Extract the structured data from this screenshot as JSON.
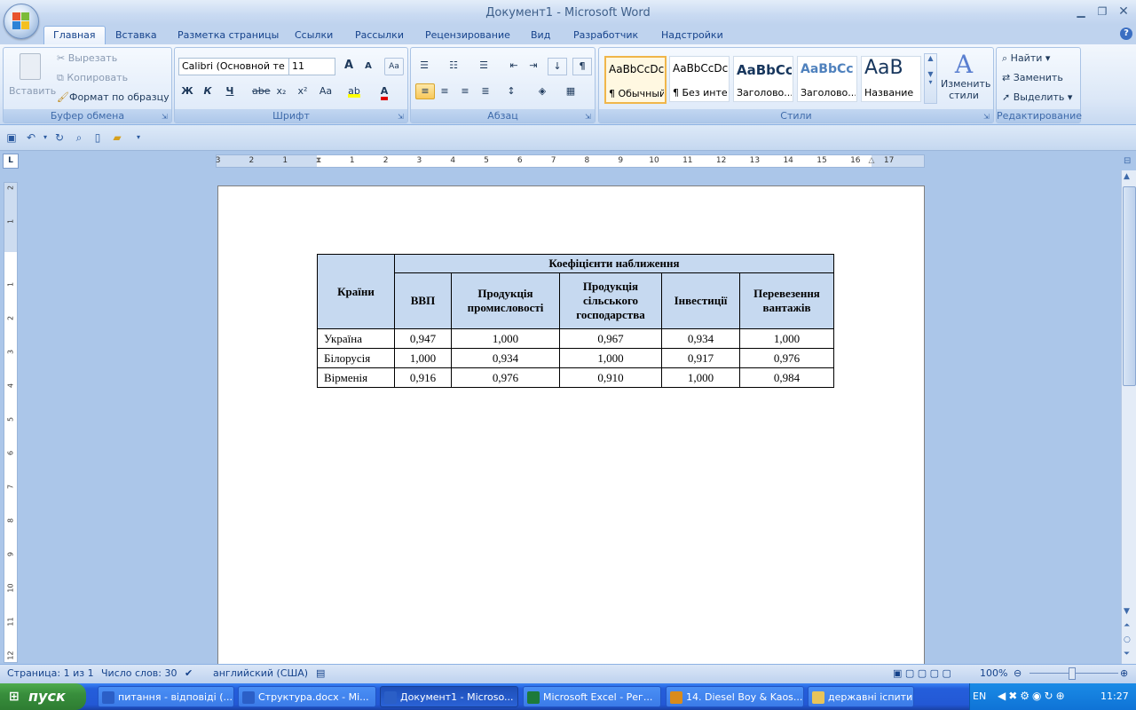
{
  "window": {
    "title": "Документ1 - Microsoft Word"
  },
  "tabs": [
    "Главная",
    "Вставка",
    "Разметка страницы",
    "Ссылки",
    "Рассылки",
    "Рецензирование",
    "Вид",
    "Разработчик",
    "Надстройки"
  ],
  "clipboard": {
    "paste": "Вставить",
    "cut": "Вырезать",
    "copy": "Копировать",
    "format_painter": "Формат по образцу",
    "label": "Буфер обмена"
  },
  "font": {
    "name": "Calibri (Основной те",
    "size": "11",
    "label": "Шрифт",
    "bold": "Ж",
    "italic": "К",
    "underline": "Ч",
    "strike": "abe",
    "sub": "x₂",
    "sup": "x²",
    "case": "Aa",
    "grow": "A",
    "shrink": "A"
  },
  "paragraph": {
    "label": "Абзац",
    "pilcrow": "¶"
  },
  "styles": {
    "label": "Стили",
    "items": [
      {
        "sample": "AaBbCcDc",
        "name": "¶ Обычный"
      },
      {
        "sample": "AaBbCcDc",
        "name": "¶ Без инте..."
      },
      {
        "sample": "AaBbCc",
        "name": "Заголово..."
      },
      {
        "sample": "AaBbCc",
        "name": "Заголово..."
      },
      {
        "sample": "AaB",
        "name": "Название"
      }
    ],
    "change_styles": "Изменить стили"
  },
  "editing": {
    "find": "Найти",
    "replace": "Заменить",
    "select": "Выделить",
    "label": "Редактирование"
  },
  "ruler": {
    "numbers": [
      "3",
      "2",
      "1",
      "1",
      "2",
      "3",
      "4",
      "5",
      "6",
      "7",
      "8",
      "9",
      "10",
      "11",
      "12",
      "13",
      "14",
      "15",
      "16",
      "17"
    ],
    "vnumbers": [
      "2",
      "1",
      "1",
      "2",
      "3",
      "4",
      "5",
      "6",
      "7",
      "8",
      "9",
      "10",
      "11",
      "12"
    ]
  },
  "table": {
    "header_col": "Країни",
    "group_header": "Коефіцієнти наближення",
    "columns": [
      "ВВП",
      "Продукція промисловості",
      "Продукція сільського господарства",
      "Інвестиції",
      "Перевезення вантажів"
    ],
    "rows": [
      {
        "country": "Україна",
        "values": [
          "0,947",
          "1,000",
          "0,967",
          "0,934",
          "1,000"
        ]
      },
      {
        "country": "Білорусія",
        "values": [
          "1,000",
          "0,934",
          "1,000",
          "0,917",
          "0,976"
        ]
      },
      {
        "country": "Вірменія",
        "values": [
          "0,916",
          "0,976",
          "0,910",
          "1,000",
          "0,984"
        ]
      }
    ]
  },
  "status": {
    "page": "Страница: 1 из 1",
    "words": "Число слов: 30",
    "language": "английский (США)",
    "zoom": "100%"
  },
  "taskbar": {
    "start": "пуск",
    "items": [
      {
        "label": "питання - відповіді (...",
        "color": "#2b5fc7"
      },
      {
        "label": "Структура.docx - Mi...",
        "color": "#2b5fc7"
      },
      {
        "label": "Документ1 - Microso...",
        "color": "#2b5fc7"
      },
      {
        "label": "Microsoft Excel - Рег...",
        "color": "#1d7a3a"
      },
      {
        "label": "14. Diesel Boy & Kaos...",
        "color": "#d98b1c"
      },
      {
        "label": "державні іспити",
        "color": "#e8c45a"
      }
    ],
    "lang": "EN",
    "time": "11:27"
  }
}
